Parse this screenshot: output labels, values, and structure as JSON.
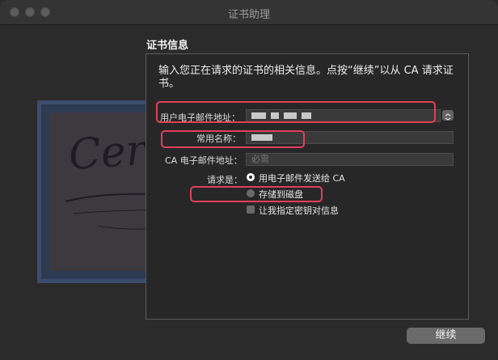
{
  "window": {
    "title": "证书助理"
  },
  "pane": {
    "heading": "证书信息",
    "intro": "输入您正在请求的证书的相关信息。点按“继续”以从 CA 请求证书。"
  },
  "form": {
    "email_label": "用户电子邮件地址：",
    "common_name_label": "常用名称：",
    "ca_email_label": "CA 电子邮件地址：",
    "ca_email_placeholder": "必需",
    "request_label": "请求是：",
    "option_email_ca": "用电子邮件发送给 CA",
    "option_save_disk": "存储到磁盘",
    "option_specify_key": "让我指定密钥对信息",
    "selected_option": "用电子邮件发送给 CA",
    "specify_key_checked": false
  },
  "footer": {
    "continue_label": "继续"
  },
  "colors": {
    "highlight": "#e0405a",
    "window_bg": "#2c2b2b"
  },
  "icons": [
    "close-icon",
    "minimize-icon",
    "zoom-icon",
    "chevron-updown-icon",
    "certificate-icon"
  ]
}
